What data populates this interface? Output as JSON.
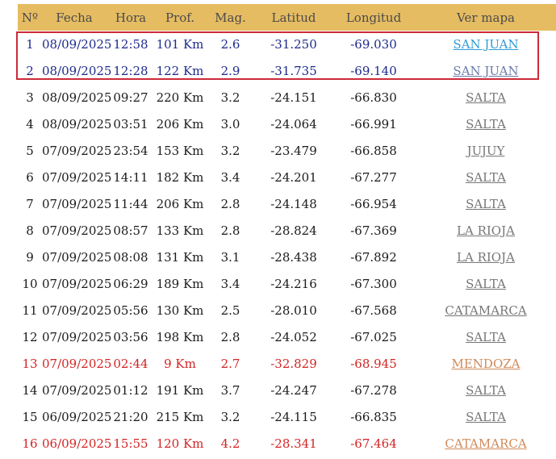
{
  "headers": [
    "Nº",
    "Fecha",
    "Hora",
    "Prof.",
    "Mag.",
    "Latitud",
    "Longitud",
    "Ver mapa"
  ],
  "colors": {
    "header_bg": "#e6bc62",
    "highlight_border": "#cc2b3a",
    "recent": "#1d2a8a",
    "alert": "#d32424"
  },
  "rows": [
    {
      "n": "1",
      "fecha": "08/09/2025",
      "hora": "12:58",
      "prof": "101 Km",
      "mag": "2.6",
      "lat": "-31.250",
      "lon": "-69.030",
      "lugar": "SAN JUAN",
      "style": "blue first"
    },
    {
      "n": "2",
      "fecha": "08/09/2025",
      "hora": "12:28",
      "prof": "122 Km",
      "mag": "2.9",
      "lat": "-31.735",
      "lon": "-69.140",
      "lugar": "SAN JUAN",
      "style": "blue"
    },
    {
      "n": "3",
      "fecha": "08/09/2025",
      "hora": "09:27",
      "prof": "220 Km",
      "mag": "3.2",
      "lat": "-24.151",
      "lon": "-66.830",
      "lugar": "SALTA",
      "style": ""
    },
    {
      "n": "4",
      "fecha": "08/09/2025",
      "hora": "03:51",
      "prof": "206 Km",
      "mag": "3.0",
      "lat": "-24.064",
      "lon": "-66.991",
      "lugar": "SALTA",
      "style": ""
    },
    {
      "n": "5",
      "fecha": "07/09/2025",
      "hora": "23:54",
      "prof": "153 Km",
      "mag": "3.2",
      "lat": "-23.479",
      "lon": "-66.858",
      "lugar": "JUJUY",
      "style": ""
    },
    {
      "n": "6",
      "fecha": "07/09/2025",
      "hora": "14:11",
      "prof": "182 Km",
      "mag": "3.4",
      "lat": "-24.201",
      "lon": "-67.277",
      "lugar": "SALTA",
      "style": ""
    },
    {
      "n": "7",
      "fecha": "07/09/2025",
      "hora": "11:44",
      "prof": "206 Km",
      "mag": "2.8",
      "lat": "-24.148",
      "lon": "-66.954",
      "lugar": "SALTA",
      "style": ""
    },
    {
      "n": "8",
      "fecha": "07/09/2025",
      "hora": "08:57",
      "prof": "133 Km",
      "mag": "2.8",
      "lat": "-28.824",
      "lon": "-67.369",
      "lugar": "LA RIOJA",
      "style": ""
    },
    {
      "n": "9",
      "fecha": "07/09/2025",
      "hora": "08:08",
      "prof": "131 Km",
      "mag": "3.1",
      "lat": "-28.438",
      "lon": "-67.892",
      "lugar": "LA RIOJA",
      "style": ""
    },
    {
      "n": "10",
      "fecha": "07/09/2025",
      "hora": "06:29",
      "prof": "189 Km",
      "mag": "3.4",
      "lat": "-24.216",
      "lon": "-67.300",
      "lugar": "SALTA",
      "style": ""
    },
    {
      "n": "11",
      "fecha": "07/09/2025",
      "hora": "05:56",
      "prof": "130 Km",
      "mag": "2.5",
      "lat": "-28.010",
      "lon": "-67.568",
      "lugar": "CATAMARCA",
      "style": ""
    },
    {
      "n": "12",
      "fecha": "07/09/2025",
      "hora": "03:56",
      "prof": "198 Km",
      "mag": "2.8",
      "lat": "-24.052",
      "lon": "-67.025",
      "lugar": "SALTA",
      "style": ""
    },
    {
      "n": "13",
      "fecha": "07/09/2025",
      "hora": "02:44",
      "prof": "9 Km",
      "mag": "2.7",
      "lat": "-32.829",
      "lon": "-68.945",
      "lugar": "MENDOZA",
      "style": "red"
    },
    {
      "n": "14",
      "fecha": "07/09/2025",
      "hora": "01:12",
      "prof": "191 Km",
      "mag": "3.7",
      "lat": "-24.247",
      "lon": "-67.278",
      "lugar": "SALTA",
      "style": ""
    },
    {
      "n": "15",
      "fecha": "06/09/2025",
      "hora": "21:20",
      "prof": "215 Km",
      "mag": "3.2",
      "lat": "-24.115",
      "lon": "-66.835",
      "lugar": "SALTA",
      "style": ""
    },
    {
      "n": "16",
      "fecha": "06/09/2025",
      "hora": "15:55",
      "prof": "120 Km",
      "mag": "4.2",
      "lat": "-28.341",
      "lon": "-67.464",
      "lugar": "CATAMARCA",
      "style": "red"
    }
  ]
}
